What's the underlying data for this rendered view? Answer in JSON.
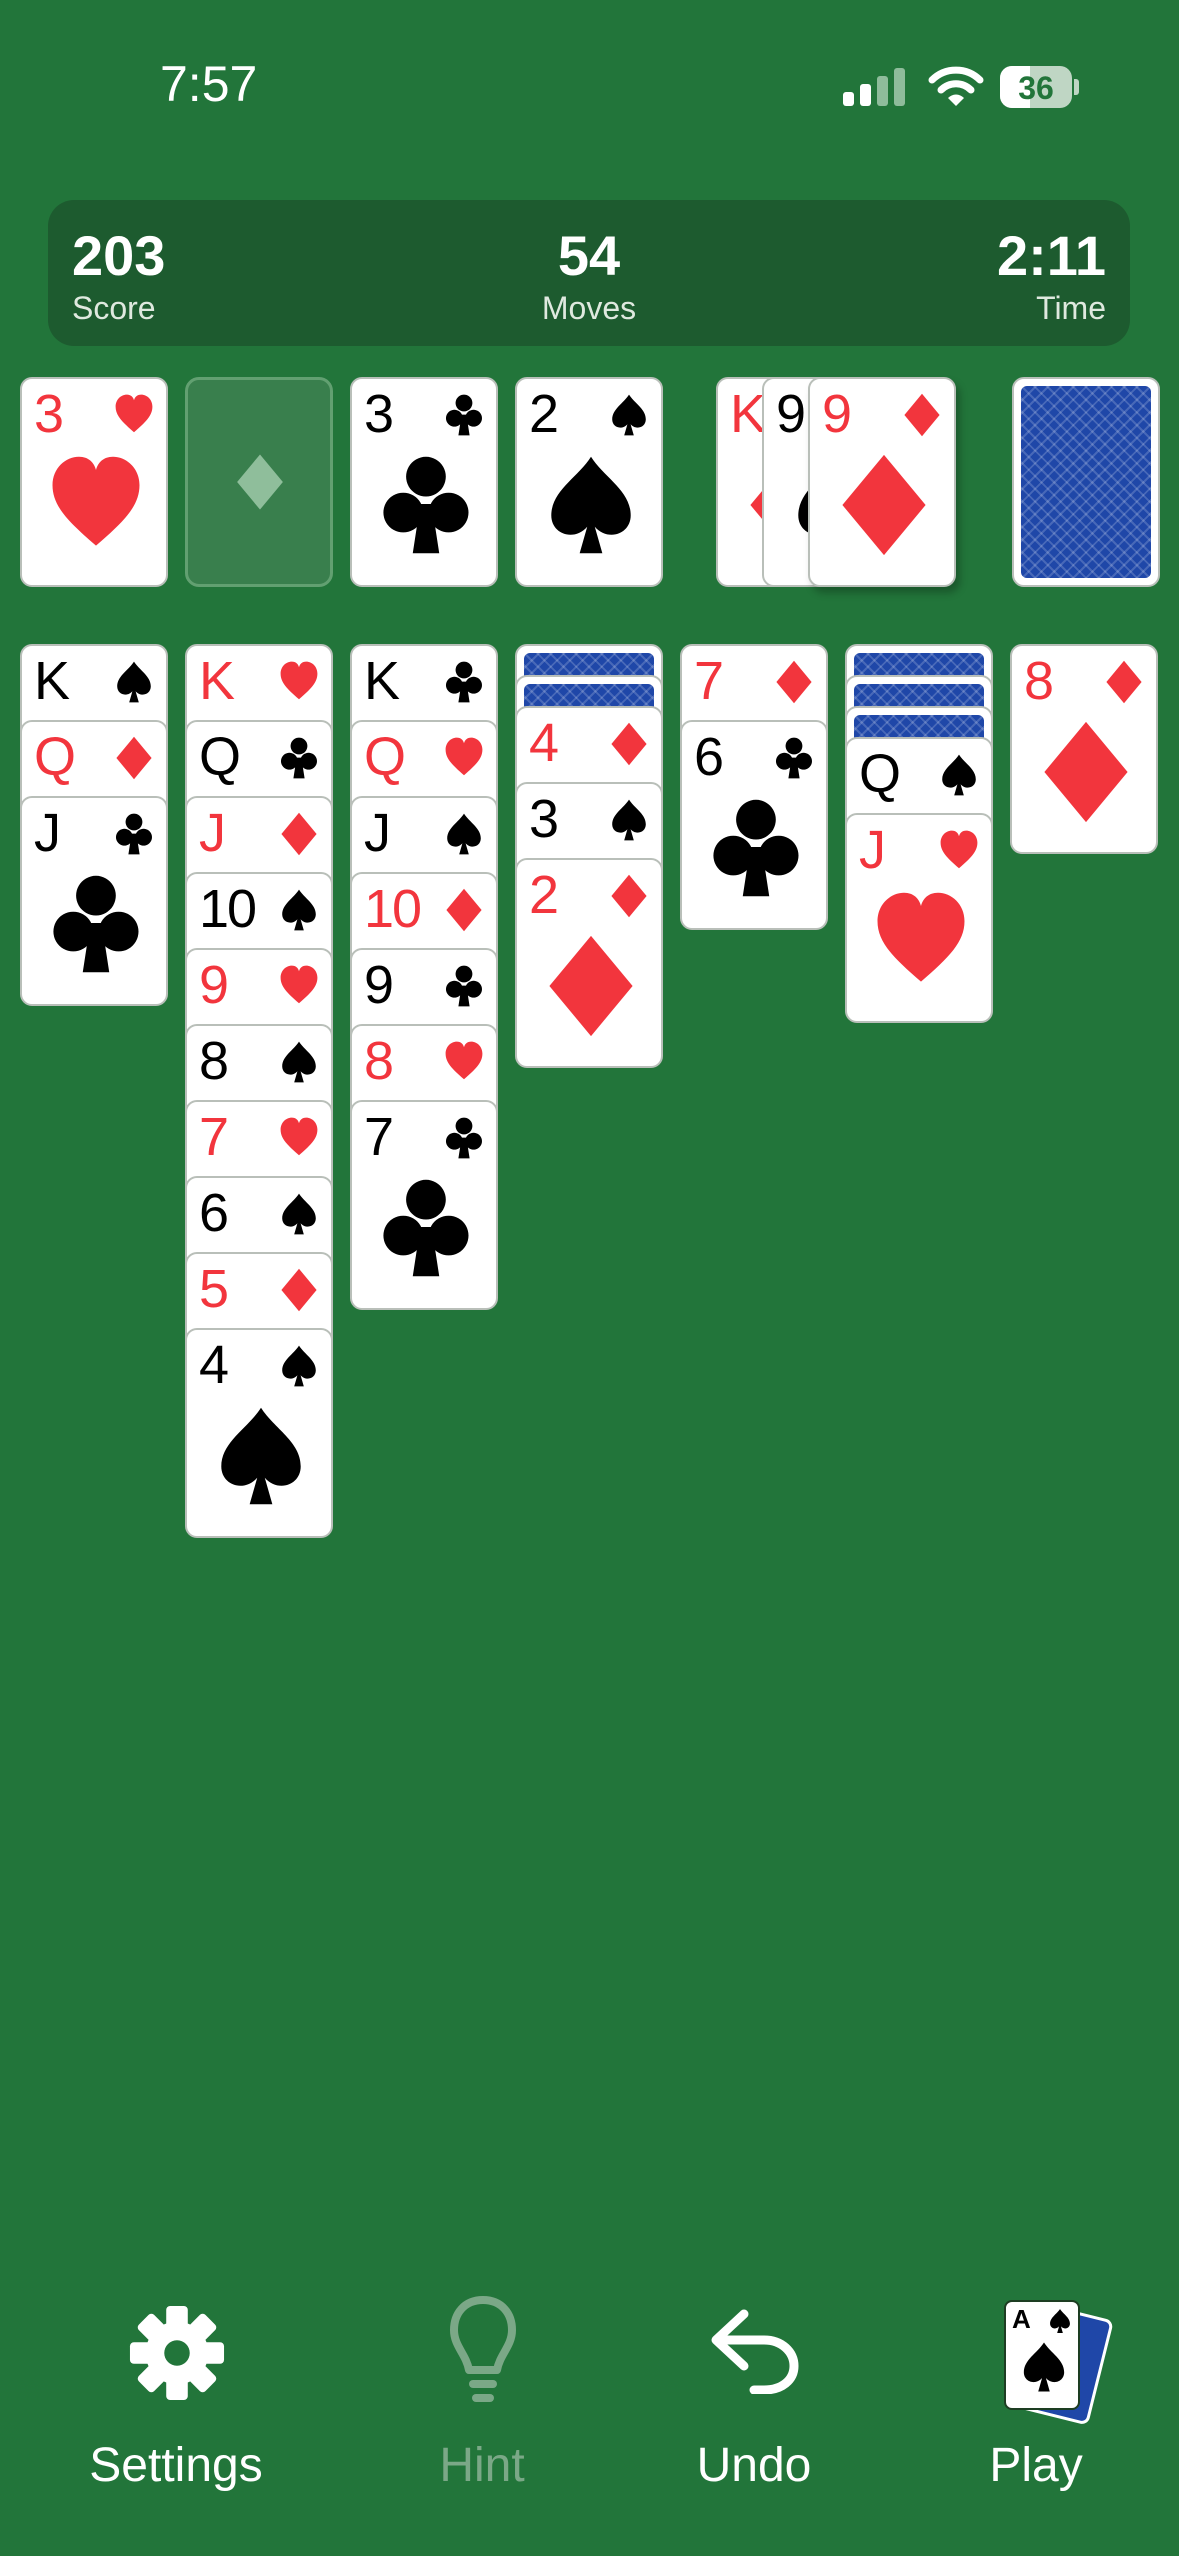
{
  "status_bar": {
    "time": "7:57",
    "battery": "36"
  },
  "stats": {
    "score": {
      "value": "203",
      "label": "Score"
    },
    "moves": {
      "value": "54",
      "label": "Moves"
    },
    "time": {
      "value": "2:11",
      "label": "Time"
    }
  },
  "foundations": [
    {
      "rank": "3",
      "suit": "hearts"
    },
    {
      "empty": true,
      "suit": "diamonds"
    },
    {
      "rank": "3",
      "suit": "clubs"
    },
    {
      "rank": "2",
      "suit": "spades"
    }
  ],
  "waste": [
    {
      "rank": "K",
      "suit": "diamonds"
    },
    {
      "rank": "9",
      "suit": "spades"
    },
    {
      "rank": "9",
      "suit": "diamonds"
    }
  ],
  "stock": {
    "face_down": true
  },
  "tableau": [
    {
      "face_down": 0,
      "cards": [
        {
          "rank": "K",
          "suit": "spades"
        },
        {
          "rank": "Q",
          "suit": "diamonds"
        },
        {
          "rank": "J",
          "suit": "clubs"
        }
      ]
    },
    {
      "face_down": 0,
      "cards": [
        {
          "rank": "K",
          "suit": "hearts"
        },
        {
          "rank": "Q",
          "suit": "clubs"
        },
        {
          "rank": "J",
          "suit": "diamonds"
        },
        {
          "rank": "10",
          "suit": "spades"
        },
        {
          "rank": "9",
          "suit": "hearts"
        },
        {
          "rank": "8",
          "suit": "spades"
        },
        {
          "rank": "7",
          "suit": "hearts"
        },
        {
          "rank": "6",
          "suit": "spades"
        },
        {
          "rank": "5",
          "suit": "diamonds"
        },
        {
          "rank": "4",
          "suit": "spades"
        }
      ]
    },
    {
      "face_down": 0,
      "cards": [
        {
          "rank": "K",
          "suit": "clubs"
        },
        {
          "rank": "Q",
          "suit": "hearts"
        },
        {
          "rank": "J",
          "suit": "spades"
        },
        {
          "rank": "10",
          "suit": "diamonds"
        },
        {
          "rank": "9",
          "suit": "clubs"
        },
        {
          "rank": "8",
          "suit": "hearts"
        },
        {
          "rank": "7",
          "suit": "clubs"
        }
      ]
    },
    {
      "face_down": 2,
      "cards": [
        {
          "rank": "4",
          "suit": "diamonds"
        },
        {
          "rank": "3",
          "suit": "spades"
        },
        {
          "rank": "2",
          "suit": "diamonds"
        }
      ]
    },
    {
      "face_down": 0,
      "cards": [
        {
          "rank": "7",
          "suit": "diamonds"
        },
        {
          "rank": "6",
          "suit": "clubs"
        }
      ]
    },
    {
      "face_down": 3,
      "cards": [
        {
          "rank": "Q",
          "suit": "spades"
        },
        {
          "rank": "J",
          "suit": "hearts"
        }
      ]
    },
    {
      "face_down": 0,
      "cards": [
        {
          "rank": "8",
          "suit": "diamonds"
        }
      ]
    }
  ],
  "toolbar": {
    "settings": {
      "label": "Settings",
      "icon": "gear-icon"
    },
    "hint": {
      "label": "Hint",
      "icon": "lightbulb-icon",
      "disabled": true
    },
    "undo": {
      "label": "Undo",
      "icon": "undo-arrow-icon"
    },
    "play": {
      "label": "Play",
      "icon": "cards-icon",
      "card_rank": "A",
      "card_suit": "spades"
    }
  },
  "colors": {
    "felt": "#22753a",
    "panel": "#1d5b2f",
    "red_suit": "#f2353d",
    "card_back": "#1f47a8"
  }
}
